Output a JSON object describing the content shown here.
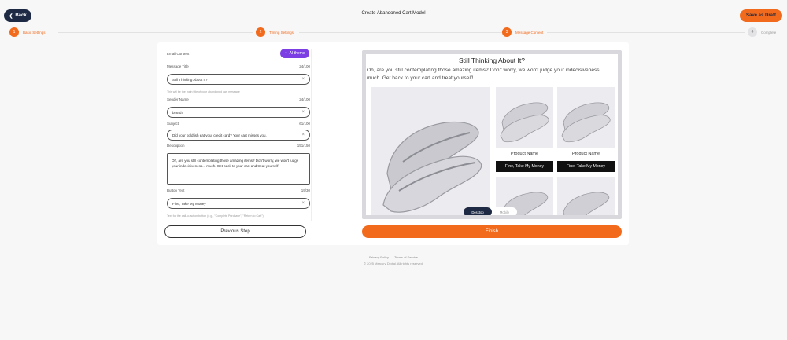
{
  "header": {
    "back_label": "Back",
    "title": "Create Abandoned Cart Model",
    "draft_label": "Save as Draft"
  },
  "steps": [
    {
      "num": "1",
      "label": "Basic Settings",
      "active": true
    },
    {
      "num": "2",
      "label": "Timing Settings",
      "active": true
    },
    {
      "num": "3",
      "label": "Message Content",
      "active": true
    },
    {
      "num": "4",
      "label": "Complete",
      "active": false
    }
  ],
  "form": {
    "section_label": "Email Content",
    "ai_label": "AI theme",
    "message_title": {
      "label": "Message Title",
      "count": "24/100",
      "value": "Still Thinking About It?",
      "hint": "This will be the main title of your abandoned cart message"
    },
    "sender_name": {
      "label": "Sender Name",
      "count": "24/100",
      "value": "brandT"
    },
    "subject": {
      "label": "Subject",
      "count": "61/100",
      "value": "Did your goldfish eat your credit card? Your cart misses you."
    },
    "description": {
      "label": "Description",
      "count": "151/150",
      "value": "Oh, are you still contemplating those amazing items? Don't worry, we won't judge your indecisiveness... much. Get back to your cart and treat yourself!"
    },
    "button_text": {
      "label": "Button Text",
      "count": "19/30",
      "value": "Fine, Take My Money",
      "hint": "Text for the call-to-action button (e.g., \"Complete Purchase\", \"Return to Cart\")"
    }
  },
  "preview": {
    "title": "Still Thinking About It?",
    "description": "Oh, are you still contemplating those amazing items? Don't worry, we won't judge your indecisiveness... much. Get back to your cart and treat yourself!",
    "products": [
      {
        "name": "Product Name",
        "button": "Fine, Take My Money"
      },
      {
        "name": "Product Name",
        "button": "Fine, Take My Money"
      }
    ],
    "toggle_desktop": "Desktop",
    "toggle_mobile": "Mobile"
  },
  "actions": {
    "previous": "Previous Step",
    "finish": "Finish"
  },
  "footer": {
    "privacy": "Privacy Policy",
    "terms": "Terms of Service",
    "copyright": "© 2025 Mercury Digital. All rights reserved."
  },
  "colors": {
    "accent": "#f26a1b",
    "navy": "#1e2a44",
    "ai": "#7b3fe4"
  }
}
